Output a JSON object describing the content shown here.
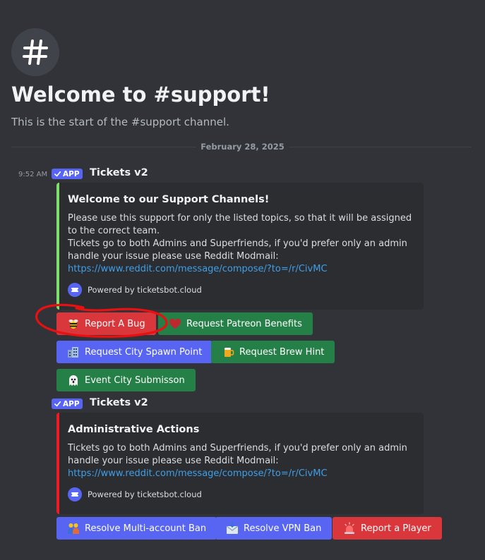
{
  "header": {
    "channel_icon": "hash-icon",
    "title": "Welcome to #support!",
    "subtitle": "This is the start of the #support channel."
  },
  "date_divider": "February 28, 2025",
  "messages": [
    {
      "timestamp": "9:52 AM",
      "badge": "APP",
      "author": "Tickets v2",
      "embed": {
        "accent_color": "#7ee06c",
        "title": "Welcome to our Support Channels!",
        "line1": "Please use this support for only the listed topics, so that it will be assigned to the correct team.",
        "line2": "Tickets go to both Admins and Superfriends, if you'd prefer only an admin handle your issue please use Reddit Modmail:",
        "link": "https://www.reddit.com/message/compose/?to=/r/CivMC",
        "footer": "Powered by ticketsbot.cloud"
      },
      "buttons": [
        {
          "label": "Report A Bug",
          "icon": "bee-icon",
          "color": "#da373c"
        },
        {
          "label": "Request Patreon Benefits",
          "icon": "heart-icon",
          "color": "#248046"
        },
        {
          "label": "Request City Spawn Point",
          "icon": "city-icon",
          "color": "#5865f2"
        },
        {
          "label": "Request Brew Hint",
          "icon": "beer-icon",
          "color": "#248046"
        },
        {
          "label": "Event City Submisson",
          "icon": "ghost-icon",
          "color": "#248046"
        }
      ]
    },
    {
      "badge": "APP",
      "author": "Tickets v2",
      "embed": {
        "accent_color": "#ed1c24",
        "title": "Administrative Actions",
        "line1": "Tickets go to both Admins and Superfriends, if you'd prefer only an admin handle your issue please use Reddit Modmail:",
        "link": "https://www.reddit.com/message/compose/?to=/r/CivMC",
        "footer": "Powered by ticketsbot.cloud"
      },
      "buttons": [
        {
          "label": "Resolve Multi-account Ban",
          "icon": "people-icon",
          "color": "#5865f2"
        },
        {
          "label": "Resolve VPN Ban",
          "icon": "envelope-icon",
          "color": "#5865f2"
        },
        {
          "label": "Report a Player",
          "icon": "siren-icon",
          "color": "#da373c"
        }
      ]
    }
  ],
  "annotation_color": "#e81010"
}
